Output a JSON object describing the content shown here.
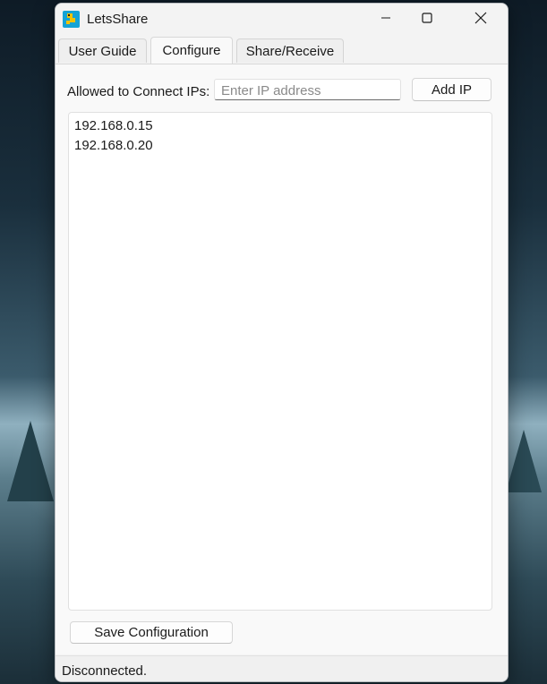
{
  "window": {
    "title": "LetsShare"
  },
  "tabs": [
    {
      "label": "User Guide"
    },
    {
      "label": "Configure"
    },
    {
      "label": "Share/Receive"
    }
  ],
  "active_tab": "Configure",
  "configure": {
    "allowed_label": "Allowed to Connect IPs:",
    "ip_input": {
      "value": "",
      "placeholder": "Enter IP address"
    },
    "add_ip_label": "Add IP",
    "ip_list": [
      "192.168.0.15",
      "192.168.0.20"
    ],
    "save_label": "Save Configuration"
  },
  "status": {
    "text": "Disconnected."
  },
  "icons": {
    "app": "letsshare-app-icon",
    "minimize": "minimize-icon",
    "maximize": "maximize-icon",
    "close": "close-icon"
  },
  "colors": {
    "app_icon_bg": "#14a3d6",
    "app_icon_fg": "#f2c200"
  }
}
